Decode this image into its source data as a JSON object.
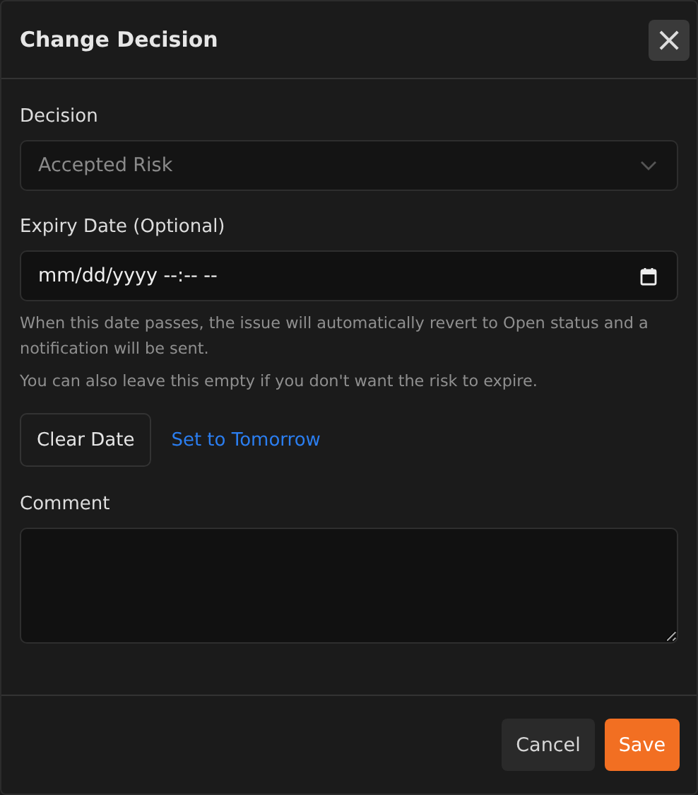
{
  "dialog": {
    "title": "Change Decision",
    "close": "×"
  },
  "decision": {
    "label": "Decision",
    "value": "Accepted Risk",
    "disabled": true
  },
  "expiry": {
    "label": "Expiry Date (Optional)",
    "placeholder": "mm/dd/yyyy --:-- --",
    "help": [
      "When this date passes, the issue will automatically revert to Open status and a notification will be sent.",
      "You can also leave this empty if you don't want the risk to expire."
    ],
    "clear_button": "Clear Date",
    "tomorrow_link": "Set to Tomorrow"
  },
  "comment": {
    "label": "Comment"
  },
  "buttons": [
    {
      "label": "Cancel",
      "kind": "secondary"
    },
    {
      "label": "Save",
      "kind": "primary"
    }
  ]
}
